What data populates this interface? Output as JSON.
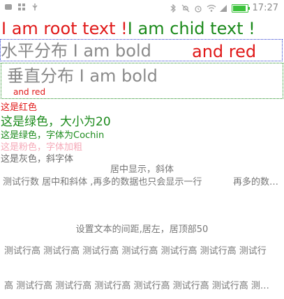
{
  "status_bar": {
    "time": "17:27",
    "icons": [
      "notification-icon",
      "grid-icon",
      "usb-icon",
      "bluetooth-icon",
      "mute-icon",
      "alarm-icon",
      "wifi-icon",
      "signal-icon",
      "battery-icon"
    ]
  },
  "root": {
    "root_text": "I am root text !",
    "child_text": "I am chid text !"
  },
  "horizontal": {
    "gray_text": "水平分布 I am bold",
    "red_text": "and red"
  },
  "vertical": {
    "gray_text": "垂直分布 I am bold",
    "red_text": "and red"
  },
  "lines": {
    "red": "这是红色",
    "green_size": "这是绿色，大小为20",
    "green_font": "这是绿色，字体为Cochin",
    "pink": "这是粉色，字体加粗",
    "gray_italic": "这是灰色，斜字体"
  },
  "center_italic": "居中显示，斜体",
  "ellipsis_mid": {
    "left": "测试行数 居中和斜体 ,再多的数据也只会显示一行",
    "right": "再多的数…"
  },
  "spacing_title": "设置文本的间距,居左，居顶部50",
  "line_height": {
    "row1": "测试行高 测试行高 测试行高 测试行高 测试行高 测试行高 测试行",
    "row2": "高 测试行高 测试行高 测试行高 测试行高 测试行高 测试行高 测…"
  },
  "colors": {
    "red": "#e01919",
    "green": "#1b8a1b",
    "gray": "#8a8a8a",
    "pink": "#f5a9b8",
    "blue_border": "#2a3bcf"
  }
}
